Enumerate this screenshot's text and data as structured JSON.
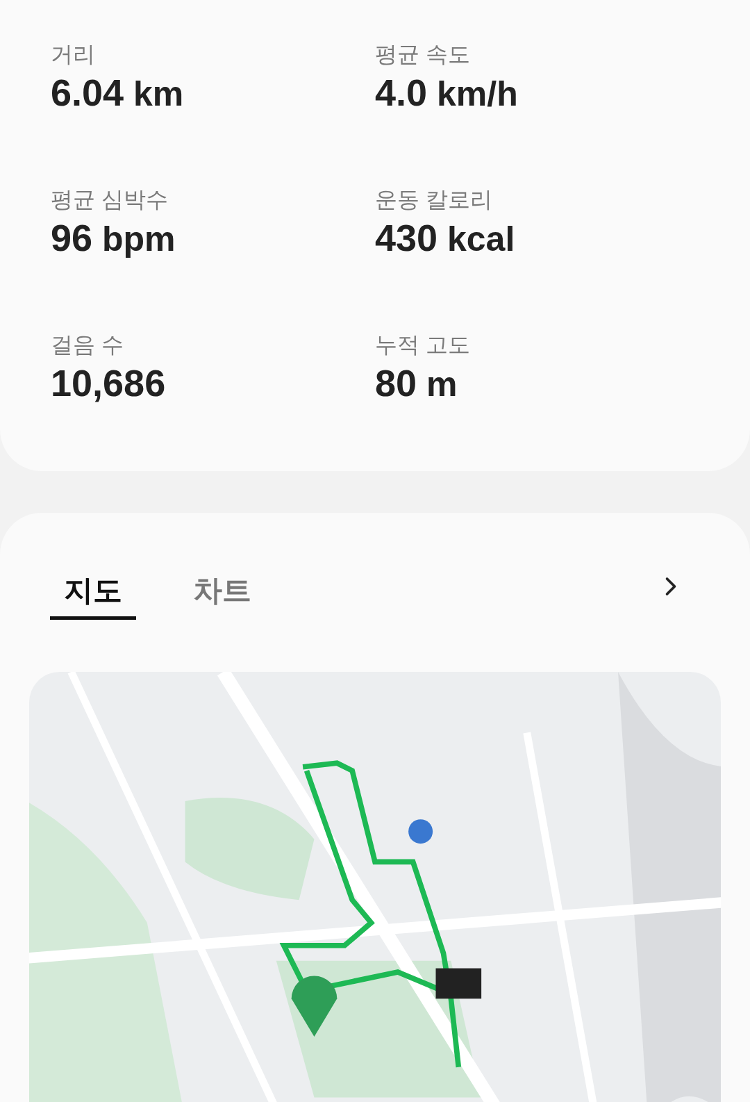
{
  "stats": [
    {
      "label": "거리",
      "value": "6.04",
      "unit": "km"
    },
    {
      "label": "평균 속도",
      "value": "4.0",
      "unit": "km/h"
    },
    {
      "label": "평균 심박수",
      "value": "96",
      "unit": "bpm"
    },
    {
      "label": "운동 칼로리",
      "value": "430",
      "unit": "kcal"
    },
    {
      "label": "걸음 수",
      "value": "10,686"
    },
    {
      "label": "누적 고도",
      "value": "80",
      "unit": "m"
    }
  ],
  "tabs": [
    {
      "label": "지도",
      "selected": true
    },
    {
      "label": "차트",
      "selected": false
    }
  ]
}
